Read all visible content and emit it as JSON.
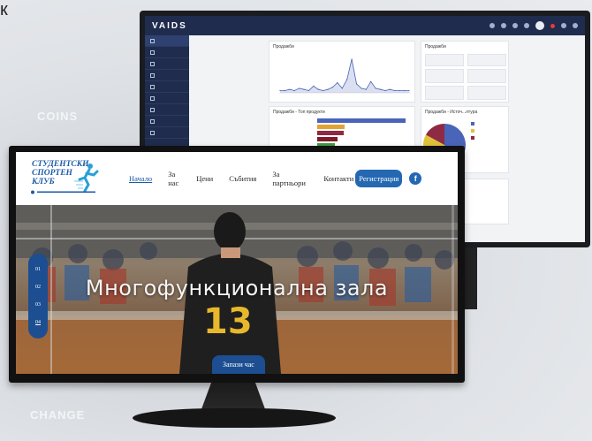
{
  "background": {
    "corner_letter": "к",
    "words": [
      "COINS",
      "CHANGE"
    ]
  },
  "dashboard": {
    "logo": "VAIDS",
    "colors": {
      "topbar": "#1f2c4d",
      "accent": "#2e4170"
    },
    "sidebar_items": [
      "",
      "",
      "",
      "",
      "",
      "",
      "",
      "",
      ""
    ],
    "sales_panel": {
      "title": "Продажби"
    },
    "stats_panel": {
      "title": "Продажби"
    },
    "category_panel": {
      "title": "Продажби - Топ продукти"
    },
    "pie_panel": {
      "title": "Продажби - Источ...лтура"
    },
    "chart_data": [
      {
        "type": "line",
        "title": "Продажби",
        "x": [
          1,
          2,
          3,
          4,
          5,
          6,
          7,
          8,
          9,
          10,
          11,
          12,
          13,
          14,
          15,
          16,
          17,
          18,
          19,
          20,
          21,
          22,
          23,
          24,
          25,
          26,
          27,
          28
        ],
        "values": [
          2,
          2,
          3,
          2,
          4,
          3,
          2,
          6,
          3,
          2,
          3,
          5,
          9,
          4,
          12,
          30,
          8,
          4,
          3,
          10,
          4,
          3,
          2,
          3,
          2,
          2,
          2,
          2
        ],
        "series_color": "#4a64b8"
      },
      {
        "type": "bar",
        "title": "Продажби - Топ продукти",
        "values": [
          100,
          31,
          30,
          23,
          20,
          13
        ],
        "colors": [
          "#4a64b8",
          "#e0a531",
          "#8e2a43",
          "#7c1b2a",
          "#3f9b45",
          "#2a7c48"
        ]
      },
      {
        "type": "pie",
        "title": "Продажби - Источ...лтура",
        "values": [
          45,
          38,
          17
        ],
        "colors": [
          "#4a64b8",
          "#e0c23a",
          "#8e2a43"
        ]
      }
    ]
  },
  "site": {
    "logo_title": "СТУДЕНТСКИ СПОРТЕН КЛУБ",
    "nav": [
      "Начало",
      "За нас",
      "Цени",
      "Събития",
      "За партньори",
      "Контакти"
    ],
    "register": "Регистрация",
    "facebook": "f",
    "hero_title": "Многофункционална зала",
    "slides": [
      "01",
      "02",
      "03",
      "04"
    ],
    "book_button": "Запази час",
    "colors": {
      "primary": "#1c4e91",
      "button": "#2468b2"
    }
  }
}
